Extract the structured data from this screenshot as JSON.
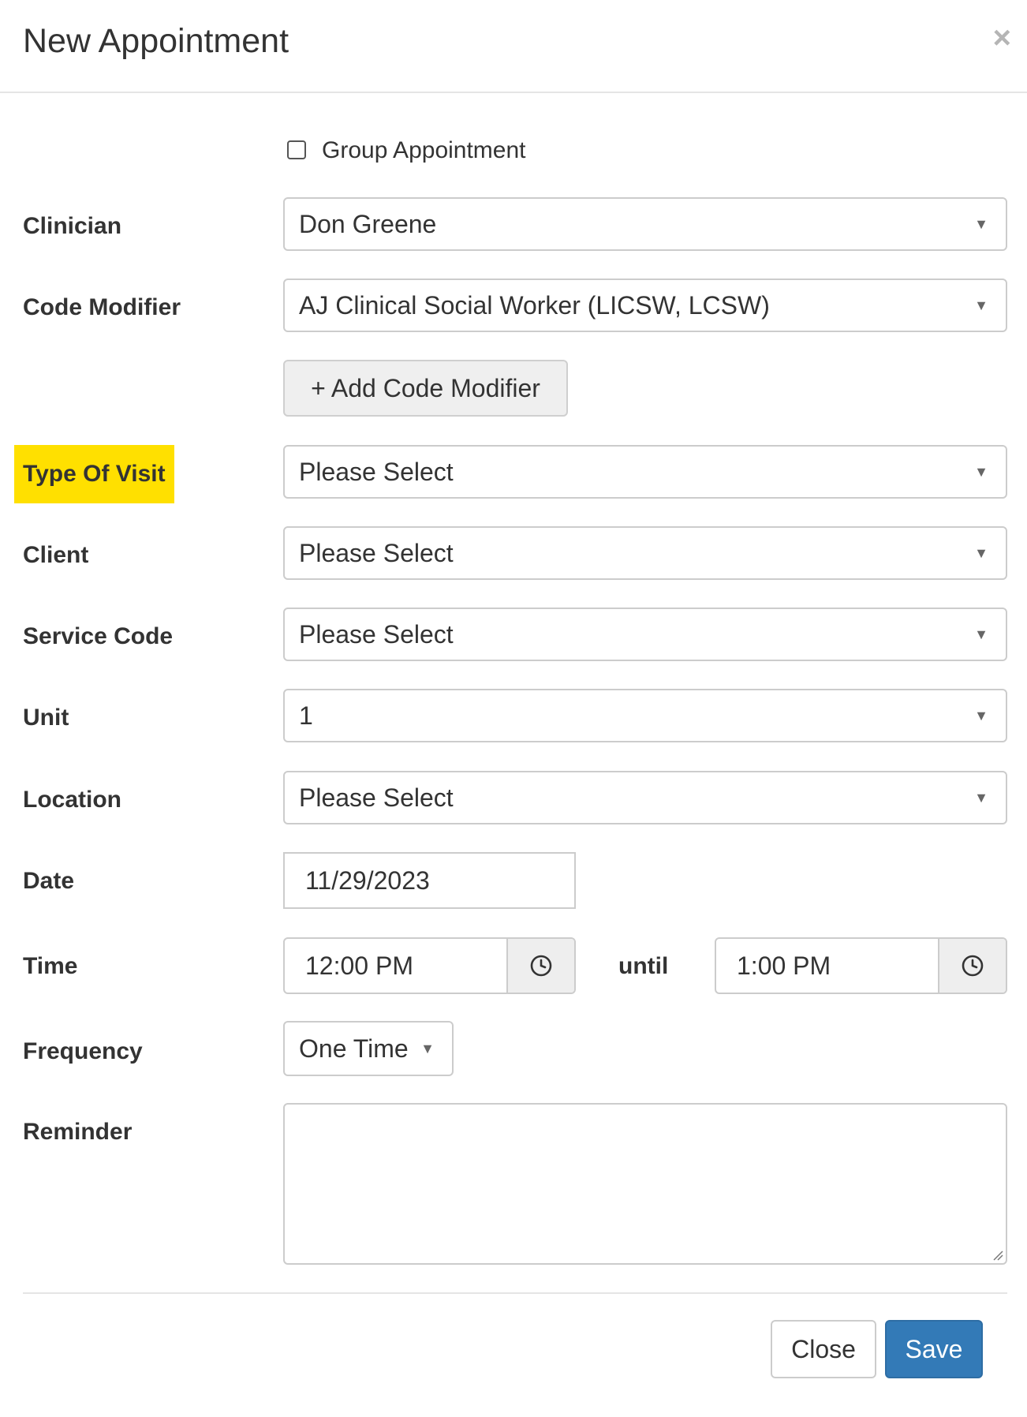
{
  "modal": {
    "title": "New Appointment",
    "close_icon": "×"
  },
  "group_appointment": {
    "label": "Group Appointment",
    "checked": false
  },
  "fields": {
    "clinician": {
      "label": "Clinician",
      "value": "Don Greene"
    },
    "code_modifier": {
      "label": "Code Modifier",
      "value": "AJ Clinical Social Worker (LICSW, LCSW)"
    },
    "add_code_modifier": "+ Add Code Modifier",
    "type_of_visit": {
      "label": "Type Of Visit",
      "value": "Please Select",
      "highlight_color": "#ffe000"
    },
    "client": {
      "label": "Client",
      "value": "Please Select"
    },
    "service_code": {
      "label": "Service Code",
      "value": "Please Select"
    },
    "unit": {
      "label": "Unit",
      "value": "1"
    },
    "location": {
      "label": "Location",
      "value": "Please Select"
    },
    "date": {
      "label": "Date",
      "value": "11/29/2023"
    },
    "time": {
      "label": "Time",
      "start": "12:00 PM",
      "until": "until",
      "end": "1:00 PM",
      "icon": "clock-icon"
    },
    "frequency": {
      "label": "Frequency",
      "value": "One Time"
    },
    "reminder": {
      "label": "Reminder",
      "value": ""
    }
  },
  "footer": {
    "close_label": "Close",
    "save_label": "Save",
    "save_color": "#337ab7"
  }
}
